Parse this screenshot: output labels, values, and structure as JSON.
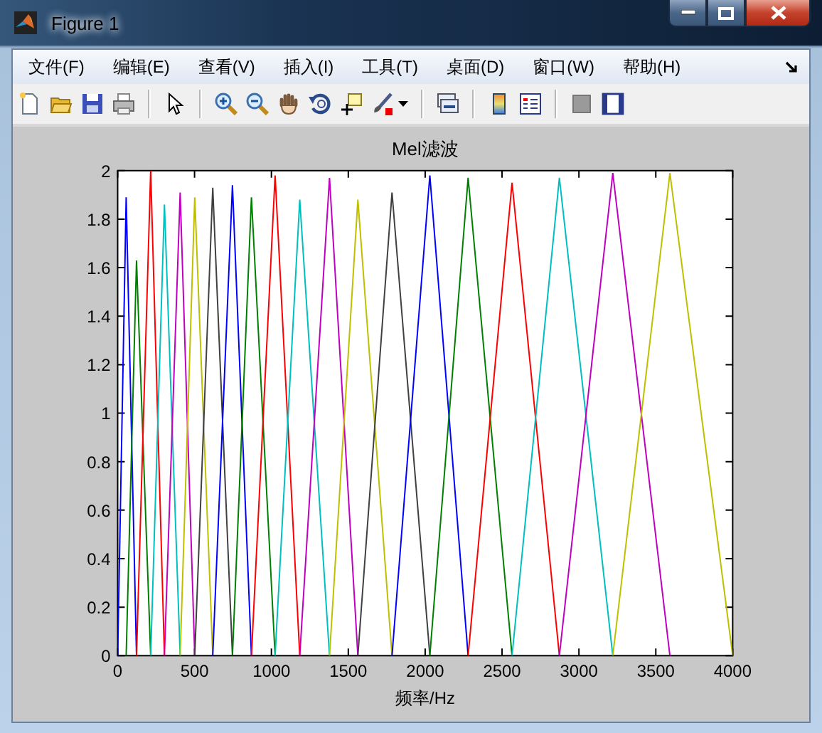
{
  "window": {
    "title": "Figure 1"
  },
  "menu_items": [
    "文件(F)",
    "编辑(E)",
    "查看(V)",
    "插入(I)",
    "工具(T)",
    "桌面(D)",
    "窗口(W)",
    "帮助(H)"
  ],
  "figure": {
    "chart_data": {
      "type": "line",
      "title": "Mel滤波",
      "xlabel": "频率/Hz",
      "x": [
        0,
        55,
        123,
        215,
        304,
        406,
        501,
        618,
        747,
        870,
        1024,
        1184,
        1378,
        1562,
        1784,
        2030,
        2279,
        2565,
        2873,
        3220,
        3592,
        4000
      ],
      "series": [
        {
          "color": "#0000ff",
          "values": [
            0,
            1.89,
            0,
            null,
            null,
            null,
            null,
            null,
            null,
            null,
            null,
            null,
            null,
            null,
            null,
            null,
            null,
            null,
            null,
            null,
            null,
            null
          ]
        },
        {
          "color": "#008000",
          "values": [
            null,
            0,
            1.63,
            0,
            null,
            null,
            null,
            null,
            null,
            null,
            null,
            null,
            null,
            null,
            null,
            null,
            null,
            null,
            null,
            null,
            null,
            null
          ]
        },
        {
          "color": "#ff0000",
          "values": [
            null,
            null,
            0,
            2.0,
            0,
            null,
            null,
            null,
            null,
            null,
            null,
            null,
            null,
            null,
            null,
            null,
            null,
            null,
            null,
            null,
            null,
            null
          ]
        },
        {
          "color": "#00bfbf",
          "values": [
            null,
            null,
            null,
            0,
            1.86,
            0,
            null,
            null,
            null,
            null,
            null,
            null,
            null,
            null,
            null,
            null,
            null,
            null,
            null,
            null,
            null,
            null
          ]
        },
        {
          "color": "#bf00bf",
          "values": [
            null,
            null,
            null,
            null,
            0,
            1.91,
            0,
            null,
            null,
            null,
            null,
            null,
            null,
            null,
            null,
            null,
            null,
            null,
            null,
            null,
            null,
            null
          ]
        },
        {
          "color": "#bfbf00",
          "values": [
            null,
            null,
            null,
            null,
            null,
            0,
            1.89,
            0,
            null,
            null,
            null,
            null,
            null,
            null,
            null,
            null,
            null,
            null,
            null,
            null,
            null,
            null
          ]
        },
        {
          "color": "#404040",
          "values": [
            null,
            null,
            null,
            null,
            null,
            null,
            0,
            1.93,
            0,
            null,
            null,
            null,
            null,
            null,
            null,
            null,
            null,
            null,
            null,
            null,
            null,
            null
          ]
        },
        {
          "color": "#0000ff",
          "values": [
            null,
            null,
            null,
            null,
            null,
            null,
            null,
            0,
            1.94,
            0,
            null,
            null,
            null,
            null,
            null,
            null,
            null,
            null,
            null,
            null,
            null,
            null
          ]
        },
        {
          "color": "#008000",
          "values": [
            null,
            null,
            null,
            null,
            null,
            null,
            null,
            null,
            0,
            1.89,
            0,
            null,
            null,
            null,
            null,
            null,
            null,
            null,
            null,
            null,
            null,
            null
          ]
        },
        {
          "color": "#ff0000",
          "values": [
            null,
            null,
            null,
            null,
            null,
            null,
            null,
            null,
            null,
            0,
            1.98,
            0,
            null,
            null,
            null,
            null,
            null,
            null,
            null,
            null,
            null,
            null
          ]
        },
        {
          "color": "#00bfbf",
          "values": [
            null,
            null,
            null,
            null,
            null,
            null,
            null,
            null,
            null,
            null,
            0,
            1.88,
            0,
            null,
            null,
            null,
            null,
            null,
            null,
            null,
            null,
            null
          ]
        },
        {
          "color": "#bf00bf",
          "values": [
            null,
            null,
            null,
            null,
            null,
            null,
            null,
            null,
            null,
            null,
            null,
            0,
            1.97,
            0,
            null,
            null,
            null,
            null,
            null,
            null,
            null,
            null
          ]
        },
        {
          "color": "#bfbf00",
          "values": [
            null,
            null,
            null,
            null,
            null,
            null,
            null,
            null,
            null,
            null,
            null,
            null,
            0,
            1.88,
            0,
            null,
            null,
            null,
            null,
            null,
            null,
            null
          ]
        },
        {
          "color": "#404040",
          "values": [
            null,
            null,
            null,
            null,
            null,
            null,
            null,
            null,
            null,
            null,
            null,
            null,
            null,
            0,
            1.91,
            0,
            null,
            null,
            null,
            null,
            null,
            null
          ]
        },
        {
          "color": "#0000ff",
          "values": [
            null,
            null,
            null,
            null,
            null,
            null,
            null,
            null,
            null,
            null,
            null,
            null,
            null,
            null,
            0,
            1.98,
            0,
            null,
            null,
            null,
            null,
            null
          ]
        },
        {
          "color": "#008000",
          "values": [
            null,
            null,
            null,
            null,
            null,
            null,
            null,
            null,
            null,
            null,
            null,
            null,
            null,
            null,
            null,
            0,
            1.97,
            0,
            null,
            null,
            null,
            null
          ]
        },
        {
          "color": "#ff0000",
          "values": [
            null,
            null,
            null,
            null,
            null,
            null,
            null,
            null,
            null,
            null,
            null,
            null,
            null,
            null,
            null,
            null,
            0,
            1.95,
            0,
            null,
            null,
            null
          ]
        },
        {
          "color": "#00bfbf",
          "values": [
            null,
            null,
            null,
            null,
            null,
            null,
            null,
            null,
            null,
            null,
            null,
            null,
            null,
            null,
            null,
            null,
            null,
            0,
            1.97,
            0,
            null,
            null
          ]
        },
        {
          "color": "#bf00bf",
          "values": [
            null,
            null,
            null,
            null,
            null,
            null,
            null,
            null,
            null,
            null,
            null,
            null,
            null,
            null,
            null,
            null,
            null,
            null,
            0,
            1.99,
            0,
            null
          ]
        },
        {
          "color": "#bfbf00",
          "values": [
            null,
            null,
            null,
            null,
            null,
            null,
            null,
            null,
            null,
            null,
            null,
            null,
            null,
            null,
            null,
            null,
            null,
            null,
            null,
            0,
            1.99,
            0
          ]
        }
      ],
      "xlim": [
        0,
        4000
      ],
      "ylim": [
        0,
        2
      ],
      "xticks": [
        0,
        500,
        1000,
        1500,
        2000,
        2500,
        3000,
        3500,
        4000
      ],
      "yticks": [
        0,
        0.2,
        0.4,
        0.6,
        0.8,
        1,
        1.2,
        1.4,
        1.6,
        1.8,
        2
      ]
    }
  }
}
